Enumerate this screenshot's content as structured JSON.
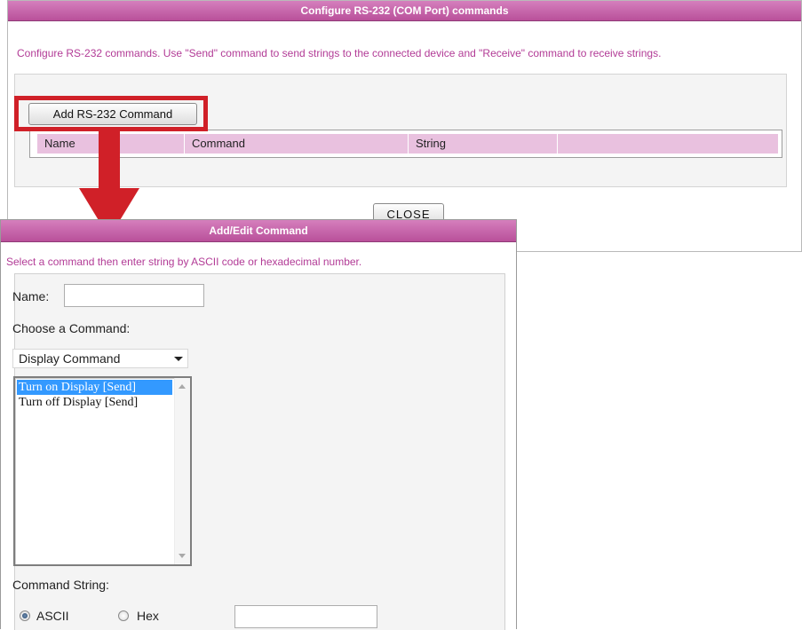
{
  "rs232_dialog": {
    "title": "Configure RS-232 (COM Port) commands",
    "description": "Configure RS-232 commands. Use \"Send\" command to send strings to the connected device and \"Receive\" command to receive strings.",
    "add_button_label": "Add RS-232 Command",
    "table_headers": [
      "Name",
      "Command",
      "String",
      ""
    ],
    "close_button_label": "CLOSE"
  },
  "edit_dialog": {
    "title": "Add/Edit Command",
    "description": "Select a command then enter string by ASCII code or hexadecimal number.",
    "name_label": "Name:",
    "name_value": "",
    "choose_label": "Choose a Command:",
    "command_type_selected": "Display Command",
    "command_options": [
      {
        "label": "Turn on Display [Send]",
        "selected": true
      },
      {
        "label": "Turn off Display [Send]",
        "selected": false
      }
    ],
    "command_string_label": "Command String:",
    "encoding_options": [
      {
        "label": "ASCII",
        "checked": true
      },
      {
        "label": "Hex",
        "checked": false
      }
    ],
    "string_value": ""
  },
  "colors": {
    "titlebar": "#c060a6",
    "description_text": "#b23b96",
    "table_header": "#e9c1df",
    "highlight_annotation": "#d02028",
    "list_selection": "#3399ff"
  },
  "icons": {
    "dropdown": "chevron-down-icon",
    "annotation_arrow": "red-down-arrow-icon"
  }
}
